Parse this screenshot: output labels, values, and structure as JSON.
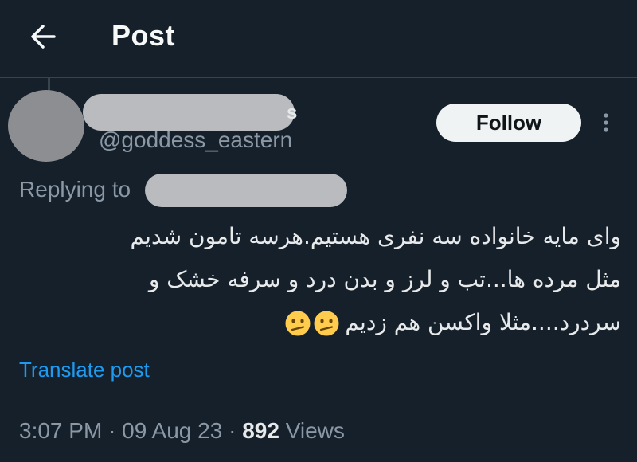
{
  "header": {
    "title": "Post"
  },
  "author": {
    "name_visible_suffix": "s",
    "handle": "@goddess_eastern",
    "follow_label": "Follow"
  },
  "reply": {
    "label": "Replying to"
  },
  "post": {
    "lines": [
      "وای مایه خانواده سه نفری هستیم.هرسه تامون شدیم",
      "مثل مرده ها...تب و لرز و بدن درد و سرفه خشک و",
      "سردرد....مثلا واکسن هم زدیم"
    ],
    "emoji": "confused-face",
    "emoji_count": 2,
    "translate_label": "Translate post"
  },
  "meta": {
    "time": "3:07 PM",
    "separator": "·",
    "date": "09 Aug 23",
    "views_count": "892",
    "views_label": "Views"
  },
  "colors": {
    "background": "#15202b",
    "link": "#1d9bf0",
    "secondary_text": "#8b98a5",
    "follow_bg": "#eff3f4"
  },
  "icons": [
    "back-arrow-icon",
    "more-vertical-icon",
    "confused-face-emoji"
  ]
}
